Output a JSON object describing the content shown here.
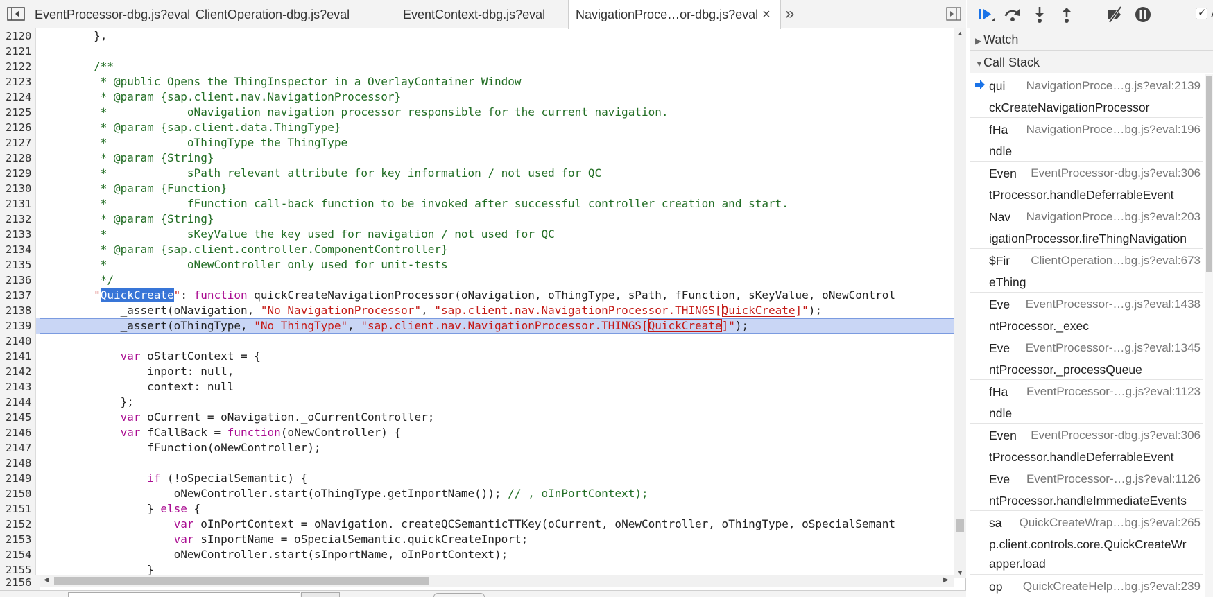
{
  "tabs": [
    {
      "label": "EventProcessor-dbg.js?eval",
      "active": false
    },
    {
      "label": "ClientOperation-dbg.js?eval",
      "active": false
    },
    {
      "label": "EventContext-dbg.js?eval",
      "active": false
    },
    {
      "label": "NavigationProce…or-dbg.js?eval",
      "active": true
    }
  ],
  "tab_close_glyph": "×",
  "tabs_more_glyph": "»",
  "code": {
    "current_line": 2139,
    "last_visible_line_number": "2156",
    "lines": [
      {
        "n": "2120",
        "tokens": [
          [
            "base",
            "        },"
          ]
        ]
      },
      {
        "n": "2121",
        "tokens": []
      },
      {
        "n": "2122",
        "tokens": [
          [
            "comment",
            "        /**"
          ]
        ]
      },
      {
        "n": "2123",
        "tokens": [
          [
            "comment",
            "         * @public Opens the ThingInspector in a OverlayContainer Window"
          ]
        ]
      },
      {
        "n": "2124",
        "tokens": [
          [
            "comment",
            "         * @param {sap.client.nav.NavigationProcessor}"
          ]
        ]
      },
      {
        "n": "2125",
        "tokens": [
          [
            "comment",
            "         *            oNavigation navigation processor responsible for the current navigation."
          ]
        ]
      },
      {
        "n": "2126",
        "tokens": [
          [
            "comment",
            "         * @param {sap.client.data.ThingType}"
          ]
        ]
      },
      {
        "n": "2127",
        "tokens": [
          [
            "comment",
            "         *            oThingType the ThingType"
          ]
        ]
      },
      {
        "n": "2128",
        "tokens": [
          [
            "comment",
            "         * @param {String}"
          ]
        ]
      },
      {
        "n": "2129",
        "tokens": [
          [
            "comment",
            "         *            sPath relevant attribute for key information / not used for QC"
          ]
        ]
      },
      {
        "n": "2130",
        "tokens": [
          [
            "comment",
            "         * @param {Function}"
          ]
        ]
      },
      {
        "n": "2131",
        "tokens": [
          [
            "comment",
            "         *            fFunction call-back function to be invoked after successful controller creation and start."
          ]
        ]
      },
      {
        "n": "2132",
        "tokens": [
          [
            "comment",
            "         * @param {String}"
          ]
        ]
      },
      {
        "n": "2133",
        "tokens": [
          [
            "comment",
            "         *            sKeyValue the key used for navigation / not used for QC"
          ]
        ]
      },
      {
        "n": "2134",
        "tokens": [
          [
            "comment",
            "         * @param {sap.client.controller.ComponentController}"
          ]
        ]
      },
      {
        "n": "2135",
        "tokens": [
          [
            "comment",
            "         *            oNewController only used for unit-tests"
          ]
        ]
      },
      {
        "n": "2136",
        "tokens": [
          [
            "comment",
            "         */"
          ]
        ]
      },
      {
        "n": "2137",
        "tokens": [
          [
            "base",
            "        "
          ],
          [
            "str",
            "\""
          ],
          [
            "sel",
            "QuickCreate"
          ],
          [
            "str",
            "\""
          ],
          [
            "base",
            ": "
          ],
          [
            "kw",
            "function"
          ],
          [
            "base",
            " quickCreateNavigationProcessor(oNavigation, oThingType, sPath, fFunction, sKeyValue, oNewControl"
          ]
        ]
      },
      {
        "n": "2138",
        "tokens": [
          [
            "base",
            "            _assert(oNavigation, "
          ],
          [
            "str",
            "\"No NavigationProcessor\""
          ],
          [
            "base",
            ", "
          ],
          [
            "str",
            "\"sap.client.nav.NavigationProcessor.THINGS["
          ],
          [
            "hl",
            "QuickCreate"
          ],
          [
            "str",
            "]\""
          ],
          [
            "base",
            ");"
          ]
        ]
      },
      {
        "n": "2139",
        "tokens": [
          [
            "base",
            "            _assert(oThingType, "
          ],
          [
            "str",
            "\"No ThingType\""
          ],
          [
            "base",
            ", "
          ],
          [
            "str",
            "\"sap.client.nav.NavigationProcessor.THINGS["
          ],
          [
            "hl",
            "QuickCreate"
          ],
          [
            "str",
            "]\""
          ],
          [
            "base",
            ");"
          ]
        ]
      },
      {
        "n": "2140",
        "tokens": []
      },
      {
        "n": "2141",
        "tokens": [
          [
            "base",
            "            "
          ],
          [
            "kw",
            "var"
          ],
          [
            "base",
            " oStartContext = {"
          ]
        ]
      },
      {
        "n": "2142",
        "tokens": [
          [
            "base",
            "                inport: null,"
          ]
        ]
      },
      {
        "n": "2143",
        "tokens": [
          [
            "base",
            "                context: null"
          ]
        ]
      },
      {
        "n": "2144",
        "tokens": [
          [
            "base",
            "            };"
          ]
        ]
      },
      {
        "n": "2145",
        "tokens": [
          [
            "base",
            "            "
          ],
          [
            "kw",
            "var"
          ],
          [
            "base",
            " oCurrent = oNavigation._oCurrentController;"
          ]
        ]
      },
      {
        "n": "2146",
        "tokens": [
          [
            "base",
            "            "
          ],
          [
            "kw",
            "var"
          ],
          [
            "base",
            " fCallBack = "
          ],
          [
            "kw",
            "function"
          ],
          [
            "base",
            "(oNewController) {"
          ]
        ]
      },
      {
        "n": "2147",
        "tokens": [
          [
            "base",
            "                fFunction(oNewController);"
          ]
        ]
      },
      {
        "n": "2148",
        "tokens": []
      },
      {
        "n": "2149",
        "tokens": [
          [
            "base",
            "                "
          ],
          [
            "kw",
            "if"
          ],
          [
            "base",
            " (!oSpecialSemantic) {"
          ]
        ]
      },
      {
        "n": "2150",
        "tokens": [
          [
            "base",
            "                    oNewController.start(oThingType.getInportName()); "
          ],
          [
            "comment",
            "// , oInPortContext);"
          ]
        ]
      },
      {
        "n": "2151",
        "tokens": [
          [
            "base",
            "                } "
          ],
          [
            "kw",
            "else"
          ],
          [
            "base",
            " {"
          ]
        ]
      },
      {
        "n": "2152",
        "tokens": [
          [
            "base",
            "                    "
          ],
          [
            "kw",
            "var"
          ],
          [
            "base",
            " oInPortContext = oNavigation._createQCSemanticTTKey(oCurrent, oNewController, oThingType, oSpecialSemant"
          ]
        ]
      },
      {
        "n": "2153",
        "tokens": [
          [
            "base",
            "                    "
          ],
          [
            "kw",
            "var"
          ],
          [
            "base",
            " sInportName = oSpecialSemantic.quickCreateInport;"
          ]
        ]
      },
      {
        "n": "2154",
        "tokens": [
          [
            "base",
            "                    oNewController.start(sInportName, oInPortContext);"
          ]
        ]
      },
      {
        "n": "2155",
        "tokens": [
          [
            "base",
            "                }"
          ]
        ]
      }
    ]
  },
  "debugger": {
    "async_label": "As",
    "async_checked": true,
    "watch_label": "Watch",
    "callstack_label": "Call Stack",
    "frames": [
      {
        "fn1": "qui",
        "loc": "NavigationProce…g.js?eval:2139",
        "fn2": "ckCreateNavigationProcessor",
        "current": true
      },
      {
        "fn1": "fHa",
        "loc": "NavigationProce…bg.js?eval:196",
        "fn2": "ndle",
        "current": false
      },
      {
        "fn1": "Even",
        "loc": "EventProcessor-dbg.js?eval:306",
        "fn2": "tProcessor.handleDeferrableEvent",
        "current": false
      },
      {
        "fn1": "Nav",
        "loc": "NavigationProce…bg.js?eval:203",
        "fn2": "igationProcessor.fireThingNavigation",
        "current": false
      },
      {
        "fn1": "$Fir",
        "loc": "ClientOperation…bg.js?eval:673",
        "fn2": "eThing",
        "current": false
      },
      {
        "fn1": "Eve",
        "loc": "EventProcessor-…g.js?eval:1438",
        "fn2": "ntProcessor._exec",
        "current": false
      },
      {
        "fn1": "Eve",
        "loc": "EventProcessor-…g.js?eval:1345",
        "fn2": "ntProcessor._processQueue",
        "current": false
      },
      {
        "fn1": "fHa",
        "loc": "EventProcessor-…g.js?eval:1123",
        "fn2": "ndle",
        "current": false
      },
      {
        "fn1": "Even",
        "loc": "EventProcessor-dbg.js?eval:306",
        "fn2": "tProcessor.handleDeferrableEvent",
        "current": false
      },
      {
        "fn1": "Eve",
        "loc": "EventProcessor-…g.js?eval:1126",
        "fn2": "ntProcessor.handleImmediateEvents",
        "current": false
      },
      {
        "fn1": "sa",
        "loc": "QuickCreateWrap…bg.js?eval:265",
        "fn2": "p.client.controls.core.QuickCreateWr",
        "fn3": "apper.load",
        "current": false
      },
      {
        "fn1": "op",
        "loc": "QuickCreateHelp…bg.js?eval:239",
        "fn2": "",
        "current": false
      }
    ]
  },
  "colors": {
    "comment": "#236e25",
    "keyword": "#aa0d91",
    "string": "#c41a16",
    "selection": "#3875d7",
    "current_line": "#c9d6f5",
    "accent": "#1a73e8"
  },
  "icons": {
    "navigator_toggle": "navigator-toggle-icon",
    "sidebar_toggle": "sidebar-toggle-icon",
    "resume": "resume-icon",
    "step_over": "step-over-icon",
    "step_into": "step-into-icon",
    "step_out": "step-out-icon",
    "deactivate_breakpoints": "deactivate-breakpoints-icon",
    "pause_on_exceptions": "pause-exceptions-icon"
  }
}
